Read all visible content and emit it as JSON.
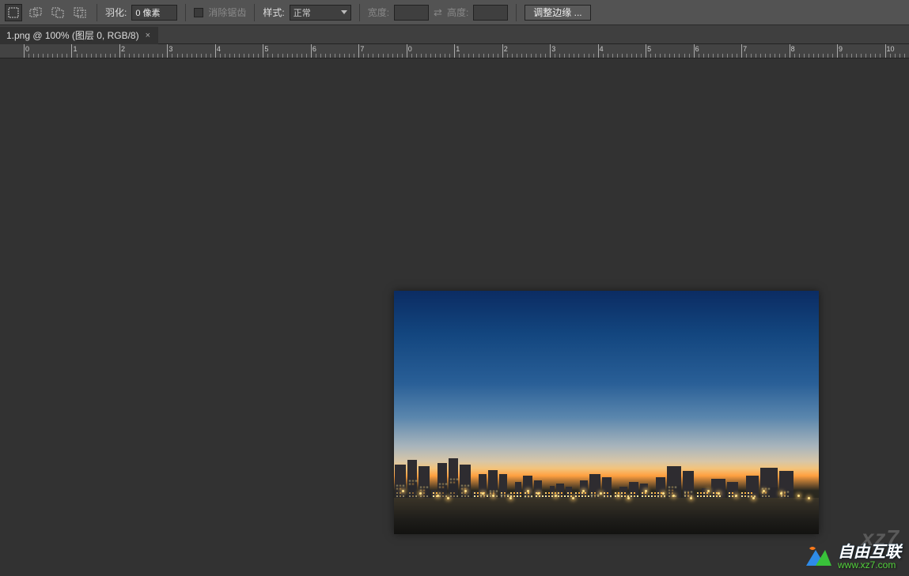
{
  "toolbar": {
    "feather_label": "羽化:",
    "feather_value": "0 像素",
    "antialias_label": "消除锯齿",
    "style_label": "样式:",
    "style_value": "正常",
    "width_label": "宽度:",
    "width_value": "",
    "height_label": "高度:",
    "height_value": "",
    "refine_edge_label": "调整边缘 ..."
  },
  "tab": {
    "title": "1.png @ 100% (图层 0, RGB/8)"
  },
  "ruler": {
    "labels": [
      "0",
      "1",
      "2",
      "3",
      "4",
      "5",
      "6",
      "7",
      "0",
      "1",
      "2",
      "3",
      "4",
      "5",
      "6",
      "7",
      "8",
      "9",
      "10"
    ]
  },
  "watermark": {
    "faint": "xz7",
    "title": "自由互联",
    "url": "www.xz7.com"
  }
}
